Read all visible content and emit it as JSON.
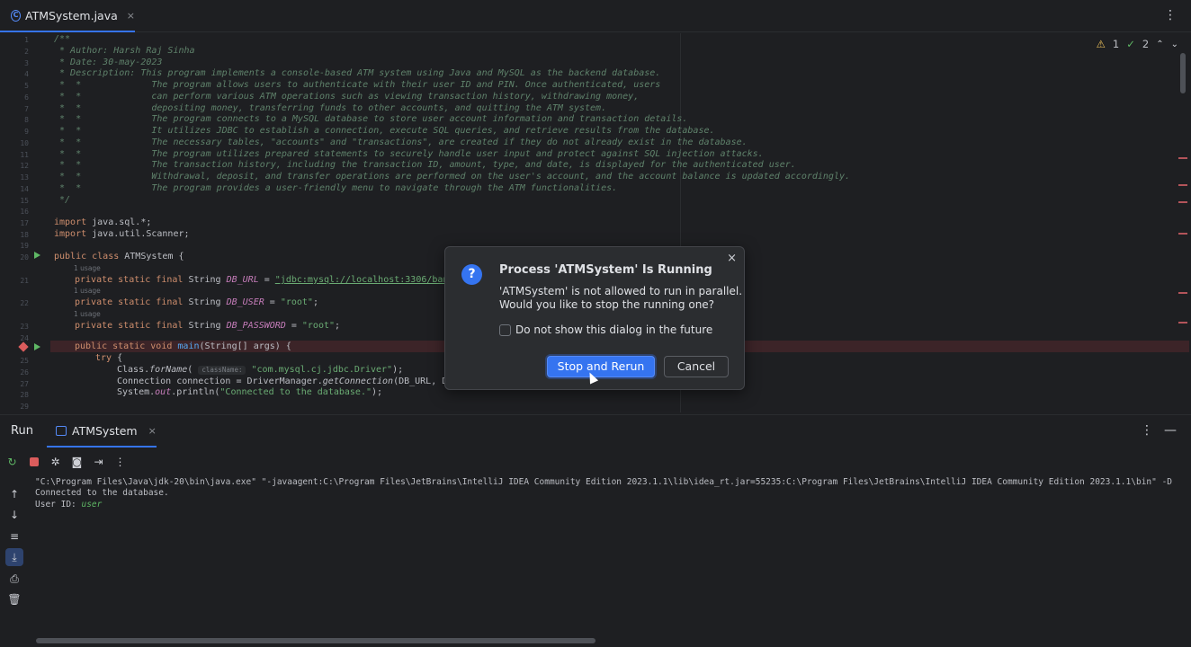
{
  "editor_tab": {
    "file_name": "ATMSystem.java",
    "close": "×"
  },
  "inspection": {
    "warnings": "1",
    "ok_count": "2"
  },
  "code": {
    "line_numbers": [
      "1",
      "2",
      "3",
      "4",
      "5",
      "6",
      "7",
      "8",
      "9",
      "10",
      "11",
      "12",
      "13",
      "14",
      "15",
      "16",
      "17",
      "18",
      "19",
      "20",
      "21",
      "22",
      "23",
      "24",
      "25",
      "26",
      "27",
      "28",
      "29"
    ],
    "doc_lines": [
      "/**",
      " * Author: Harsh Raj Sinha",
      " * Date: 30-may-2023",
      " * Description: This program implements a console-based ATM system using Java and MySQL as the backend database.",
      " *  *             The program allows users to authenticate with their user ID and PIN. Once authenticated, users",
      " *  *             can perform various ATM operations such as viewing transaction history, withdrawing money,",
      " *  *             depositing money, transferring funds to other accounts, and quitting the ATM system.",
      " *  *             The program connects to a MySQL database to store user account information and transaction details.",
      " *  *             It utilizes JDBC to establish a connection, execute SQL queries, and retrieve results from the database.",
      " *  *             The necessary tables, \"accounts\" and \"transactions\", are created if they do not already exist in the database.",
      " *  *             The program utilizes prepared statements to securely handle user input and protect against SQL injection attacks.",
      " *  *             The transaction history, including the transaction ID, amount, type, and date, is displayed for the authenticated user.",
      " *  *             Withdrawal, deposit, and transfer operations are performed on the user's account, and the account balance is updated accordingly.",
      " *  *             The program provides a user-friendly menu to navigate through the ATM functionalities.",
      " */"
    ],
    "import_kw": "import",
    "import1": " java.sql.*;",
    "import2": " java.util.Scanner;",
    "class_kw": "public class",
    "class_name": " ATMSystem {",
    "usage": "1 usage",
    "psfs": "private static final",
    "string_type": " String ",
    "db_url_name": "DB_URL",
    "db_url_val": "\"jdbc:mysql://localhost:3306/bankd",
    "db_user_name": "DB_USER",
    "db_user_val": "\"root\"",
    "db_pass_name": "DB_PASSWORD",
    "db_pass_val": "\"root\"",
    "eq": " = ",
    "semi": ";",
    "main_kw": "public static void",
    "main_name": "main",
    "main_args": "(String[] args) {",
    "try_kw": "try",
    "try_rest": " {",
    "class_forname_a": "Class.",
    "class_forname_b": "forName",
    "class_forname_hint": "className:",
    "class_forname_val": "\"com.mysql.cj.jdbc.Driver\"",
    "class_forname_end": ");",
    "conn_a": "Connection connection = DriverManager.",
    "conn_b": "getConnection",
    "conn_c": "(DB_URL, DB_",
    "println_a": "System.",
    "println_out": "out",
    "println_b": ".println(",
    "println_val": "\"Connected to the database.\"",
    "println_end": ");"
  },
  "run_panel": {
    "title": "Run",
    "tab_name": "ATMSystem",
    "close": "×",
    "console_lines": [
      "\"C:\\Program Files\\Java\\jdk-20\\bin\\java.exe\" \"-javaagent:C:\\Program Files\\JetBrains\\IntelliJ IDEA Community Edition 2023.1.1\\lib\\idea_rt.jar=55235:C:\\Program Files\\JetBrains\\IntelliJ IDEA Community Edition 2023.1.1\\bin\" -D",
      "Connected to the database."
    ],
    "prompt_label": "User ID: ",
    "prompt_input": "user"
  },
  "dialog": {
    "title": "Process 'ATMSystem' Is Running",
    "message_line1": "'ATMSystem' is not allowed to run in parallel.",
    "message_line2": "Would you like to stop the running one?",
    "checkbox_label": "Do not show this dialog in the future",
    "primary_button": "Stop and Rerun",
    "secondary_button": "Cancel",
    "close": "×",
    "icon": "?"
  },
  "colors": {
    "accent": "#3574f0",
    "background": "#1e1f22",
    "dialog_bg": "#2b2d30",
    "keyword": "#cf8e6d",
    "string": "#6aab73",
    "comment": "#5f826b",
    "error": "#db5c5c"
  }
}
